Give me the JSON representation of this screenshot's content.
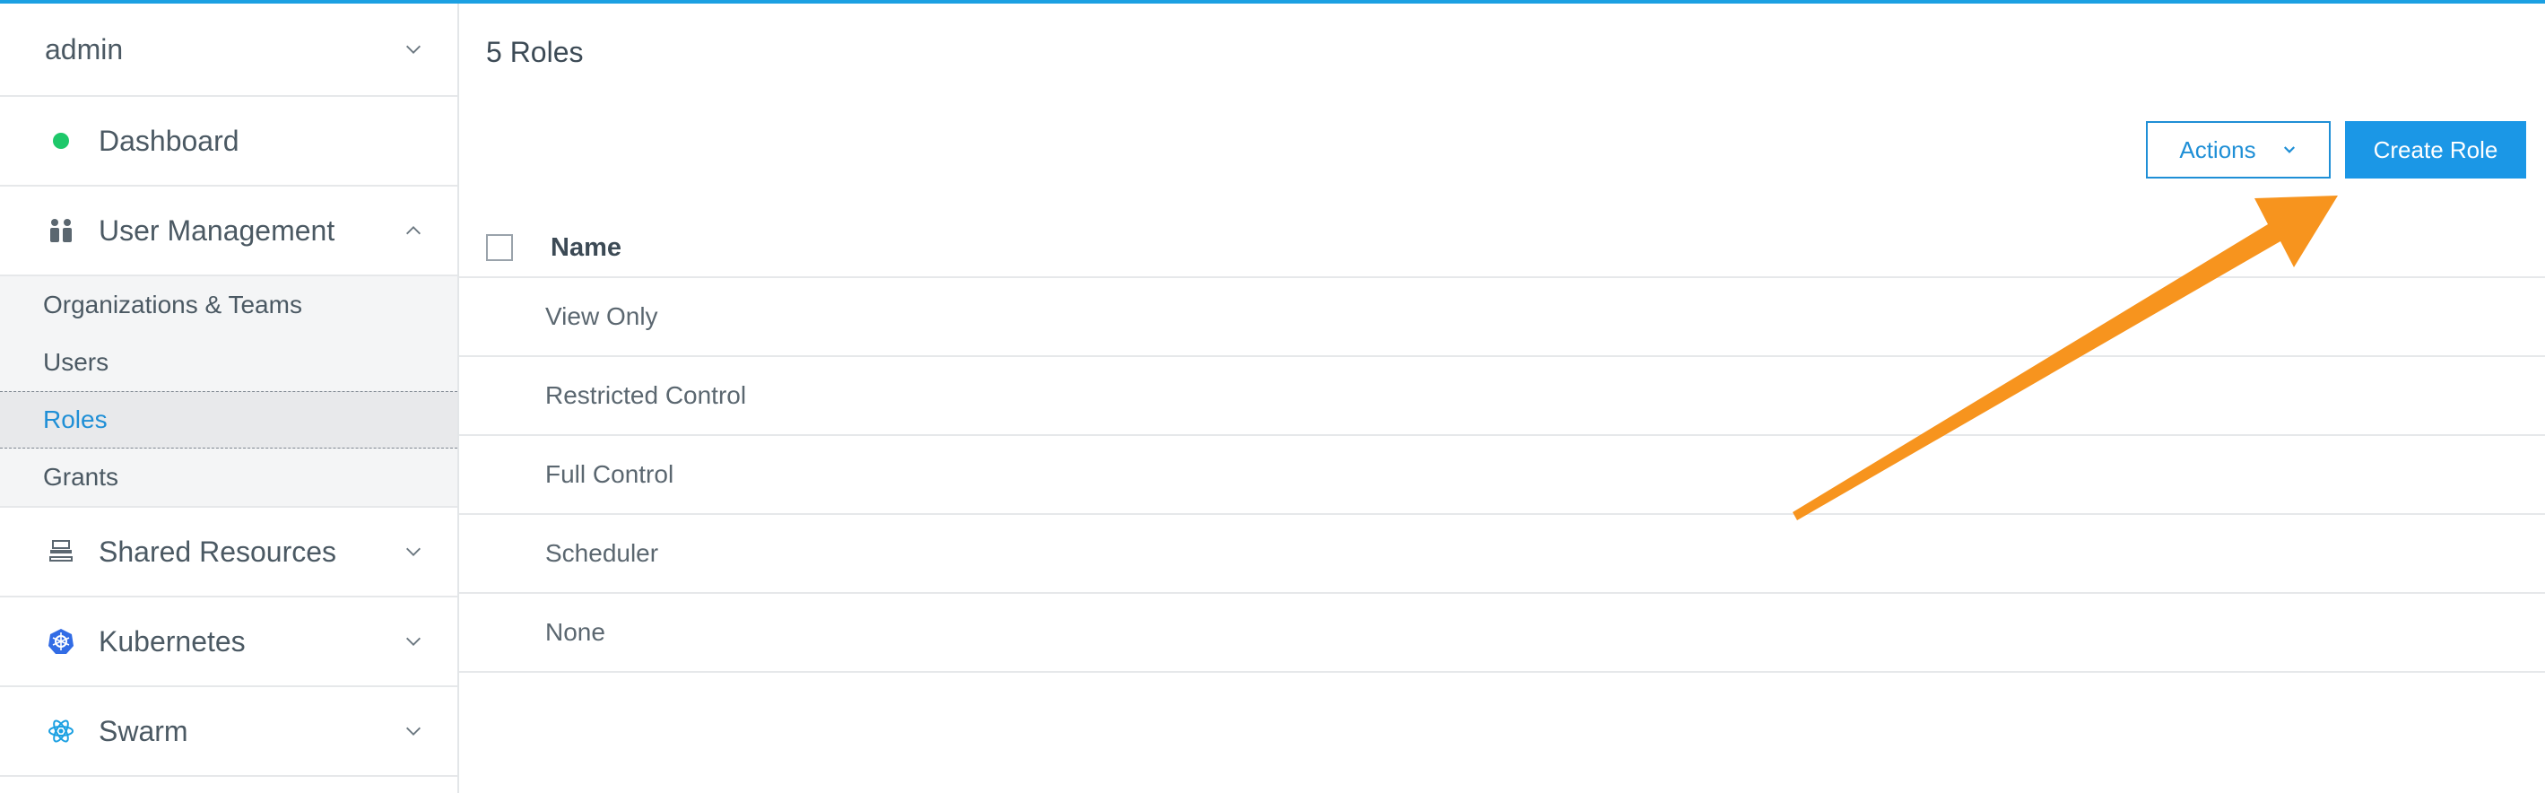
{
  "sidebar": {
    "user": "admin",
    "items": [
      {
        "label": "Dashboard",
        "icon": "status-dot-icon"
      },
      {
        "label": "User Management",
        "icon": "users-icon"
      },
      {
        "label": "Shared Resources",
        "icon": "shared-resources-icon"
      },
      {
        "label": "Kubernetes",
        "icon": "kubernetes-icon"
      },
      {
        "label": "Swarm",
        "icon": "swarm-icon"
      }
    ],
    "submenu": [
      "Organizations & Teams",
      "Users",
      "Roles",
      "Grants"
    ],
    "active": "Roles"
  },
  "main": {
    "title": "5 Roles",
    "actions_label": "Actions",
    "create_label": "Create Role",
    "table": {
      "header": "Name",
      "rows": [
        "View Only",
        "Restricted Control",
        "Full Control",
        "Scheduler",
        "None"
      ]
    }
  },
  "colors": {
    "accent": "#1b97e6",
    "annotation": "#f7941e",
    "status_green": "#1ec86a"
  }
}
